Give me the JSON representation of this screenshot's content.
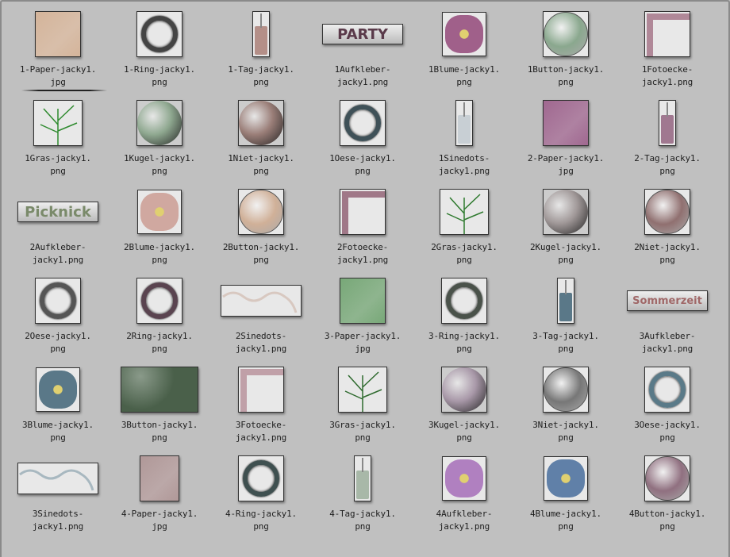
{
  "colors": {
    "background": "#c0c0c0",
    "label": "#1e1e1e"
  },
  "selected_index": 0,
  "items": [
    {
      "lines": [
        "1-Paper-jacky1.",
        "jpg"
      ],
      "kind": "paper",
      "color": "#d4b49a"
    },
    {
      "lines": [
        "1-Ring-jacky1.",
        "png"
      ],
      "kind": "ring",
      "color": "#444444"
    },
    {
      "lines": [
        "1-Tag-jacky1.",
        "png"
      ],
      "kind": "tag",
      "color": "#b48f88"
    },
    {
      "lines": [
        "1Aufkleber-",
        "jacky1.png"
      ],
      "kind": "banner",
      "color": "#5a3a4a",
      "banner_text": "PARTY"
    },
    {
      "lines": [
        "1Blume-jacky1.",
        "png"
      ],
      "kind": "flower",
      "color": "#a0608a"
    },
    {
      "lines": [
        "1Button-jacky1.",
        "png"
      ],
      "kind": "button",
      "color": "#8aa88e"
    },
    {
      "lines": [
        "1Fotoecke-",
        "jacky1.png"
      ],
      "kind": "corner",
      "color": "#b08898"
    },
    {
      "lines": [
        "1Gras-jacky1.",
        "png"
      ],
      "kind": "grass",
      "color": "#2e8a2e"
    },
    {
      "lines": [
        "1Kugel-jacky1.",
        "png"
      ],
      "kind": "sphere",
      "color": "#8fa890"
    },
    {
      "lines": [
        "1Niet-jacky1.",
        "png"
      ],
      "kind": "sphere",
      "color": "#9a7e78"
    },
    {
      "lines": [
        "1Oese-jacky1.",
        "png"
      ],
      "kind": "ring",
      "color": "#3f5158"
    },
    {
      "lines": [
        "1Sinedots-",
        "jacky1.png"
      ],
      "kind": "tag",
      "color": "#c8cfd4"
    },
    {
      "lines": [
        "2-Paper-jacky1.",
        "jpg"
      ],
      "kind": "paper",
      "color": "#a06890"
    },
    {
      "lines": [
        "2-Tag-jacky1.",
        "png"
      ],
      "kind": "tag",
      "color": "#a07890"
    },
    {
      "lines": [
        "2Aufkleber-",
        "jacky1.png"
      ],
      "kind": "banner",
      "color": "#7a8a6a",
      "banner_text": "Picknick"
    },
    {
      "lines": [
        "2Blume-jacky1.",
        "png"
      ],
      "kind": "flower",
      "color": "#d0a8a0"
    },
    {
      "lines": [
        "2Button-jacky1.",
        "png"
      ],
      "kind": "button",
      "color": "#d0b098"
    },
    {
      "lines": [
        "2Fotoecke-",
        "jacky1.png"
      ],
      "kind": "corner",
      "color": "#a07888"
    },
    {
      "lines": [
        "2Gras-jacky1.",
        "png"
      ],
      "kind": "grass",
      "color": "#2e7a2e"
    },
    {
      "lines": [
        "2Kugel-jacky1.",
        "png"
      ],
      "kind": "sphere",
      "color": "#a09898"
    },
    {
      "lines": [
        "2Niet-jacky1.",
        "png"
      ],
      "kind": "button",
      "color": "#907070"
    },
    {
      "lines": [
        "2Oese-jacky1.",
        "png"
      ],
      "kind": "ring",
      "color": "#555555"
    },
    {
      "lines": [
        "2Ring-jacky1.",
        "png"
      ],
      "kind": "ring",
      "color": "#5a4450"
    },
    {
      "lines": [
        "2Sinedots-",
        "jacky1.png"
      ],
      "kind": "wide",
      "color": "#d8c8c0"
    },
    {
      "lines": [
        "3-Paper-jacky1.",
        "jpg"
      ],
      "kind": "paper",
      "color": "#78a878"
    },
    {
      "lines": [
        "3-Ring-jacky1.",
        "png"
      ],
      "kind": "ring",
      "color": "#4a524a"
    },
    {
      "lines": [
        "3-Tag-jacky1.",
        "png"
      ],
      "kind": "tag",
      "color": "#5a7888"
    },
    {
      "lines": [
        "3Aufkleber-",
        "jacky1.png"
      ],
      "kind": "banner",
      "color": "#a06868",
      "banner_text": "Sommerzeit"
    },
    {
      "lines": [
        "3Blume-jacky1.",
        "png"
      ],
      "kind": "flower",
      "color": "#5a7888"
    },
    {
      "lines": [
        "3Button-jacky1.",
        "png"
      ],
      "kind": "widebutton",
      "color": "#4a604a"
    },
    {
      "lines": [
        "3Fotoecke-",
        "jacky1.png"
      ],
      "kind": "corner",
      "color": "#c0a0a8"
    },
    {
      "lines": [
        "3Gras-jacky1.",
        "png"
      ],
      "kind": "grass",
      "color": "#2e6a2e"
    },
    {
      "lines": [
        "3Kugel-jacky1.",
        "png"
      ],
      "kind": "sphere",
      "color": "#a898a8"
    },
    {
      "lines": [
        "3Niet-jacky1.",
        "png"
      ],
      "kind": "button",
      "color": "#777777"
    },
    {
      "lines": [
        "3Oese-jacky1.",
        "png"
      ],
      "kind": "ring",
      "color": "#5a7a88"
    },
    {
      "lines": [
        "3Sinedots-",
        "jacky1.png"
      ],
      "kind": "wide",
      "color": "#a8b8c0"
    },
    {
      "lines": [
        "4-Paper-jacky1.",
        "jpg"
      ],
      "kind": "paper-tall",
      "color": "#b09898"
    },
    {
      "lines": [
        "4-Ring-jacky1.",
        "png"
      ],
      "kind": "ring",
      "color": "#3f5050"
    },
    {
      "lines": [
        "4-Tag-jacky1.",
        "png"
      ],
      "kind": "tag",
      "color": "#a8b8a8"
    },
    {
      "lines": [
        "4Aufkleber-",
        "jacky1.png"
      ],
      "kind": "flower",
      "color": "#b080c0"
    },
    {
      "lines": [
        "4Blume-jacky1.",
        "png"
      ],
      "kind": "flower",
      "color": "#6080a8"
    },
    {
      "lines": [
        "4Button-jacky1.",
        "png"
      ],
      "kind": "button",
      "color": "#907080"
    }
  ]
}
